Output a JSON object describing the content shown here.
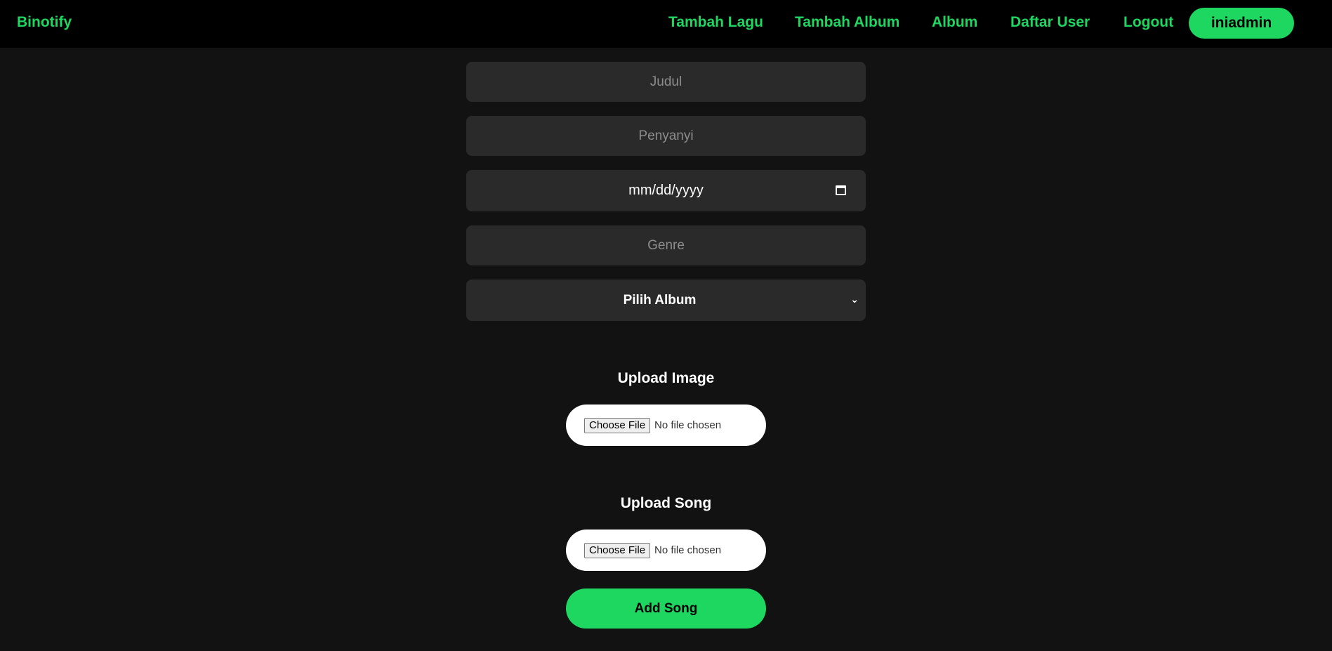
{
  "navbar": {
    "brand": "Binotify",
    "items": [
      "Tambah Lagu",
      "Tambah Album",
      "Album",
      "Daftar User",
      "Logout"
    ],
    "user": "iniadmin"
  },
  "form": {
    "title_placeholder": "Judul",
    "singer_placeholder": "Penyanyi",
    "date_value": "mm/dd/yyyy",
    "genre_placeholder": "Genre",
    "album_select": "Pilih Album",
    "upload_image_label": "Upload Image",
    "upload_song_label": "Upload Song",
    "choose_file_label": "Choose File",
    "no_file_text": "No file chosen",
    "submit_label": "Add Song"
  },
  "colors": {
    "accent": "#1ed760",
    "background": "#121212",
    "navbar": "#000000",
    "field": "#2a2a2a"
  },
  "icons": {
    "date_picker": "calendar-icon",
    "select": "chevron-down-icon"
  }
}
